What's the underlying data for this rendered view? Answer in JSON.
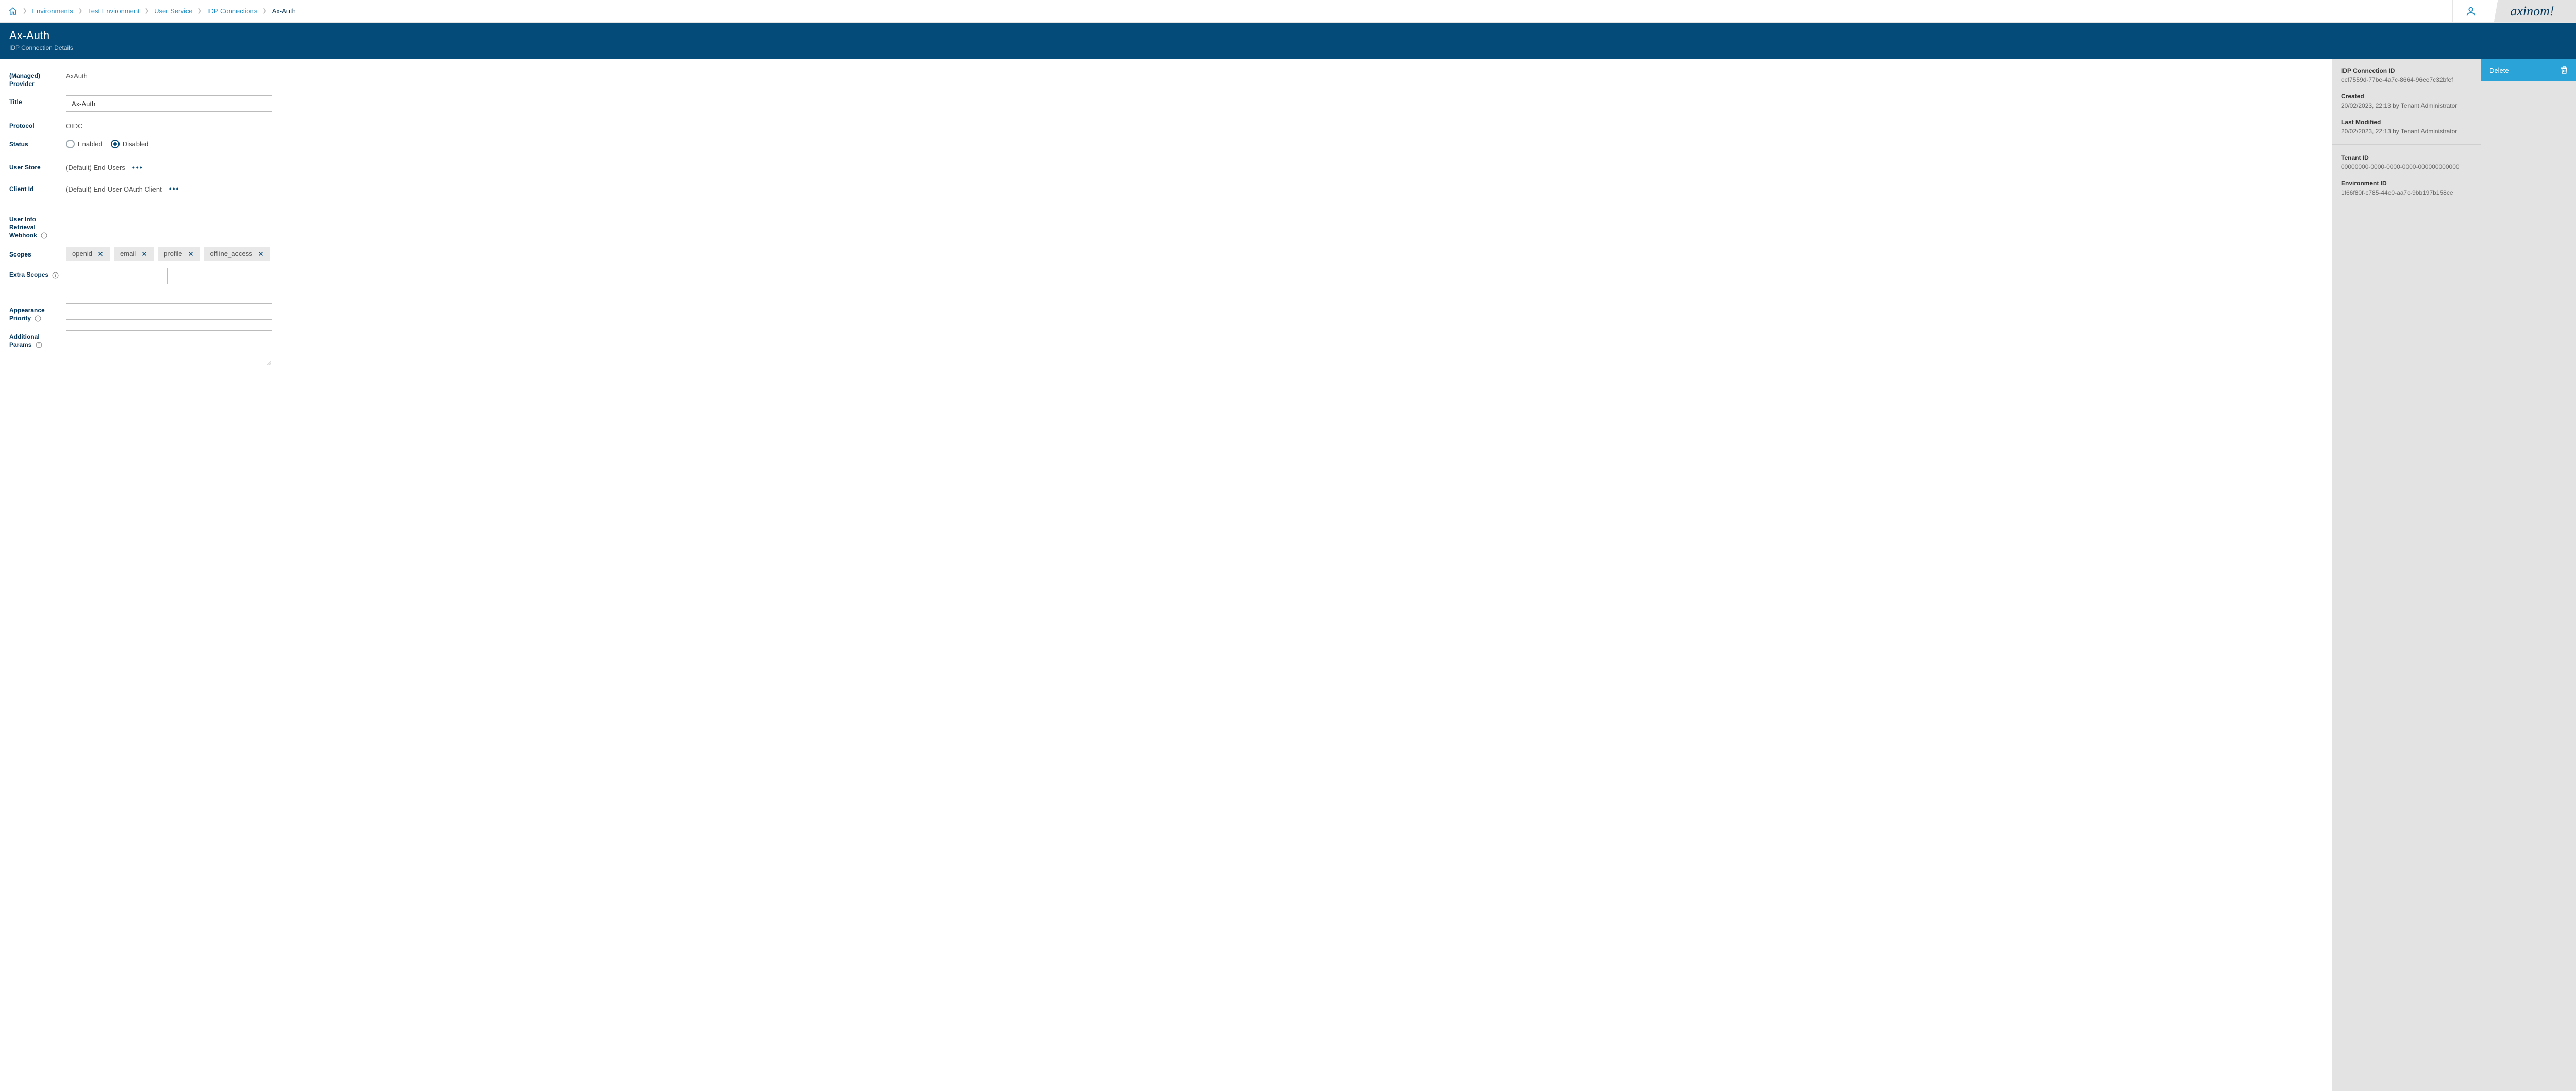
{
  "breadcrumb": {
    "items": [
      {
        "label": "Environments"
      },
      {
        "label": "Test Environment"
      },
      {
        "label": "User Service"
      },
      {
        "label": "IDP Connections"
      }
    ],
    "current": "Ax-Auth"
  },
  "brand": "axinom!",
  "header": {
    "title": "Ax-Auth",
    "subtitle": "IDP Connection Details"
  },
  "form": {
    "provider_label": "(Managed) Provider",
    "provider_value": "AxAuth",
    "title_label": "Title",
    "title_value": "Ax-Auth",
    "protocol_label": "Protocol",
    "protocol_value": "OIDC",
    "status_label": "Status",
    "status_options": {
      "enabled": "Enabled",
      "disabled": "Disabled"
    },
    "status_selected": "disabled",
    "user_store_label": "User Store",
    "user_store_value": "(Default) End-Users",
    "client_id_label": "Client Id",
    "client_id_value": "(Default) End-User OAuth Client",
    "webhook_label": "User Info Retrieval Webhook",
    "webhook_value": "",
    "scopes_label": "Scopes",
    "scopes": [
      "openid",
      "email",
      "profile",
      "offline_access"
    ],
    "extra_scopes_label": "Extra Scopes",
    "extra_scopes_value": "",
    "appearance_label": "Appearance Priority",
    "appearance_value": "",
    "additional_label": "Additional Params",
    "additional_value": ""
  },
  "meta": {
    "id_label": "IDP Connection ID",
    "id_value": "ecf7559d-77be-4a7c-8664-96ee7c32bfef",
    "created_label": "Created",
    "created_value": "20/02/2023, 22:13 by Tenant Administrator",
    "modified_label": "Last Modified",
    "modified_value": "20/02/2023, 22:13 by Tenant Administrator",
    "tenant_label": "Tenant ID",
    "tenant_value": "00000000-0000-0000-0000-000000000000",
    "env_label": "Environment ID",
    "env_value": "1f66f80f-c785-44e0-aa7c-9bb197b158ce"
  },
  "actions": {
    "delete": "Delete"
  }
}
